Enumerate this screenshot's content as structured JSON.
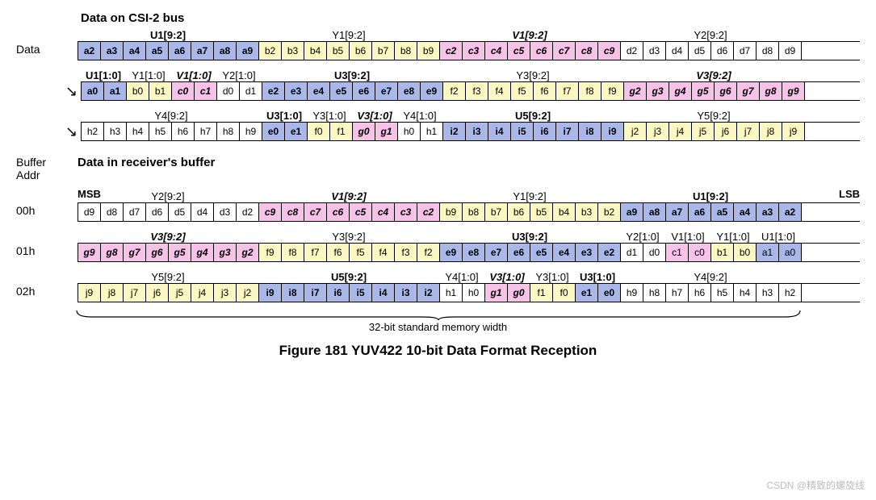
{
  "title": "Figure 181 YUV422 10-bit Data Format Reception",
  "memwidth": "32-bit standard memory width",
  "watermark": "CSDN @精致的螺旋线",
  "sections": {
    "bus": "Data on CSI-2 bus",
    "buf": "Data in receiver's buffer"
  },
  "labels": {
    "data": "Data",
    "bufaddr": "Buffer\nAddr",
    "msb": "MSB",
    "lsb": "LSB"
  },
  "bufaddrs": [
    "00h",
    "01h",
    "02h"
  ],
  "busHeaders": [
    [
      {
        "t": "U1[9:2]",
        "w": 8,
        "s": "bold"
      },
      {
        "t": "Y1[9:2]",
        "w": 8,
        "s": ""
      },
      {
        "t": "V1[9:2]",
        "w": 8,
        "s": "bold italic"
      },
      {
        "t": "Y2[9:2]",
        "w": 8,
        "s": ""
      }
    ],
    [
      {
        "t": "U1[1:0]",
        "w": 2,
        "s": "bold"
      },
      {
        "t": "Y1[1:0]",
        "w": 2,
        "s": ""
      },
      {
        "t": "V1[1:0]",
        "w": 2,
        "s": "bold italic"
      },
      {
        "t": "Y2[1:0]",
        "w": 2,
        "s": ""
      },
      {
        "t": "U3[9:2]",
        "w": 8,
        "s": "bold"
      },
      {
        "t": "Y3[9:2]",
        "w": 8,
        "s": ""
      },
      {
        "t": "V3[9:2]",
        "w": 8,
        "s": "bold italic"
      }
    ],
    [
      {
        "t": "Y4[9:2]",
        "w": 8,
        "s": ""
      },
      {
        "t": "U3[1:0]",
        "w": 2,
        "s": "bold"
      },
      {
        "t": "Y3[1:0]",
        "w": 2,
        "s": ""
      },
      {
        "t": "V3[1:0]",
        "w": 2,
        "s": "bold italic"
      },
      {
        "t": "Y4[1:0]",
        "w": 2,
        "s": ""
      },
      {
        "t": "U5[9:2]",
        "w": 8,
        "s": "bold"
      },
      {
        "t": "Y5[9:2]",
        "w": 8,
        "s": ""
      }
    ]
  ],
  "busRows": [
    [
      {
        "v": "a2",
        "c": "blue",
        "s": "bold"
      },
      {
        "v": "a3",
        "c": "blue",
        "s": "bold"
      },
      {
        "v": "a4",
        "c": "blue",
        "s": "bold"
      },
      {
        "v": "a5",
        "c": "blue",
        "s": "bold"
      },
      {
        "v": "a6",
        "c": "blue",
        "s": "bold"
      },
      {
        "v": "a7",
        "c": "blue",
        "s": "bold"
      },
      {
        "v": "a8",
        "c": "blue",
        "s": "bold"
      },
      {
        "v": "a9",
        "c": "blue",
        "s": "bold",
        "g": 1
      },
      {
        "v": "b2",
        "c": "yellow"
      },
      {
        "v": "b3",
        "c": "yellow"
      },
      {
        "v": "b4",
        "c": "yellow"
      },
      {
        "v": "b5",
        "c": "yellow"
      },
      {
        "v": "b6",
        "c": "yellow"
      },
      {
        "v": "b7",
        "c": "yellow"
      },
      {
        "v": "b8",
        "c": "yellow"
      },
      {
        "v": "b9",
        "c": "yellow",
        "g": 1
      },
      {
        "v": "c2",
        "c": "pink",
        "s": "bold italic"
      },
      {
        "v": "c3",
        "c": "pink",
        "s": "bold italic"
      },
      {
        "v": "c4",
        "c": "pink",
        "s": "bold italic"
      },
      {
        "v": "c5",
        "c": "pink",
        "s": "bold italic"
      },
      {
        "v": "c6",
        "c": "pink",
        "s": "bold italic"
      },
      {
        "v": "c7",
        "c": "pink",
        "s": "bold italic"
      },
      {
        "v": "c8",
        "c": "pink",
        "s": "bold italic"
      },
      {
        "v": "c9",
        "c": "pink",
        "s": "bold italic",
        "g": 1
      },
      {
        "v": "d2",
        "c": "white"
      },
      {
        "v": "d3",
        "c": "white"
      },
      {
        "v": "d4",
        "c": "white"
      },
      {
        "v": "d5",
        "c": "white"
      },
      {
        "v": "d6",
        "c": "white"
      },
      {
        "v": "d7",
        "c": "white"
      },
      {
        "v": "d8",
        "c": "white"
      },
      {
        "v": "d9",
        "c": "white"
      }
    ],
    [
      {
        "v": "a0",
        "c": "blue",
        "s": "bold"
      },
      {
        "v": "a1",
        "c": "blue",
        "s": "bold",
        "g": 1
      },
      {
        "v": "b0",
        "c": "yellow"
      },
      {
        "v": "b1",
        "c": "yellow",
        "g": 1
      },
      {
        "v": "c0",
        "c": "pink",
        "s": "bold italic"
      },
      {
        "v": "c1",
        "c": "pink",
        "s": "bold italic",
        "g": 1
      },
      {
        "v": "d0",
        "c": "white"
      },
      {
        "v": "d1",
        "c": "white",
        "g": 1
      },
      {
        "v": "e2",
        "c": "blue",
        "s": "bold"
      },
      {
        "v": "e3",
        "c": "blue",
        "s": "bold"
      },
      {
        "v": "e4",
        "c": "blue",
        "s": "bold"
      },
      {
        "v": "e5",
        "c": "blue",
        "s": "bold"
      },
      {
        "v": "e6",
        "c": "blue",
        "s": "bold"
      },
      {
        "v": "e7",
        "c": "blue",
        "s": "bold"
      },
      {
        "v": "e8",
        "c": "blue",
        "s": "bold"
      },
      {
        "v": "e9",
        "c": "blue",
        "s": "bold",
        "g": 1
      },
      {
        "v": "f2",
        "c": "yellow"
      },
      {
        "v": "f3",
        "c": "yellow"
      },
      {
        "v": "f4",
        "c": "yellow"
      },
      {
        "v": "f5",
        "c": "yellow"
      },
      {
        "v": "f6",
        "c": "yellow"
      },
      {
        "v": "f7",
        "c": "yellow"
      },
      {
        "v": "f8",
        "c": "yellow"
      },
      {
        "v": "f9",
        "c": "yellow",
        "g": 1
      },
      {
        "v": "g2",
        "c": "pink",
        "s": "bold italic"
      },
      {
        "v": "g3",
        "c": "pink",
        "s": "bold italic"
      },
      {
        "v": "g4",
        "c": "pink",
        "s": "bold italic"
      },
      {
        "v": "g5",
        "c": "pink",
        "s": "bold italic"
      },
      {
        "v": "g6",
        "c": "pink",
        "s": "bold italic"
      },
      {
        "v": "g7",
        "c": "pink",
        "s": "bold italic"
      },
      {
        "v": "g8",
        "c": "pink",
        "s": "bold italic"
      },
      {
        "v": "g9",
        "c": "pink",
        "s": "bold italic"
      }
    ],
    [
      {
        "v": "h2",
        "c": "white"
      },
      {
        "v": "h3",
        "c": "white"
      },
      {
        "v": "h4",
        "c": "white"
      },
      {
        "v": "h5",
        "c": "white"
      },
      {
        "v": "h6",
        "c": "white"
      },
      {
        "v": "h7",
        "c": "white"
      },
      {
        "v": "h8",
        "c": "white"
      },
      {
        "v": "h9",
        "c": "white",
        "g": 1
      },
      {
        "v": "e0",
        "c": "blue",
        "s": "bold"
      },
      {
        "v": "e1",
        "c": "blue",
        "s": "bold",
        "g": 1
      },
      {
        "v": "f0",
        "c": "yellow"
      },
      {
        "v": "f1",
        "c": "yellow",
        "g": 1
      },
      {
        "v": "g0",
        "c": "pink",
        "s": "bold italic"
      },
      {
        "v": "g1",
        "c": "pink",
        "s": "bold italic",
        "g": 1
      },
      {
        "v": "h0",
        "c": "white"
      },
      {
        "v": "h1",
        "c": "white",
        "g": 1
      },
      {
        "v": "i2",
        "c": "blue",
        "s": "bold"
      },
      {
        "v": "i3",
        "c": "blue",
        "s": "bold"
      },
      {
        "v": "i4",
        "c": "blue",
        "s": "bold"
      },
      {
        "v": "i5",
        "c": "blue",
        "s": "bold"
      },
      {
        "v": "i6",
        "c": "blue",
        "s": "bold"
      },
      {
        "v": "i7",
        "c": "blue",
        "s": "bold"
      },
      {
        "v": "i8",
        "c": "blue",
        "s": "bold"
      },
      {
        "v": "i9",
        "c": "blue",
        "s": "bold",
        "g": 1
      },
      {
        "v": "j2",
        "c": "yellow"
      },
      {
        "v": "j3",
        "c": "yellow"
      },
      {
        "v": "j4",
        "c": "yellow"
      },
      {
        "v": "j5",
        "c": "yellow"
      },
      {
        "v": "j6",
        "c": "yellow"
      },
      {
        "v": "j7",
        "c": "yellow"
      },
      {
        "v": "j8",
        "c": "yellow"
      },
      {
        "v": "j9",
        "c": "yellow"
      }
    ]
  ],
  "bufHeaders": [
    [
      {
        "t": "Y2[9:2]",
        "w": 8,
        "s": ""
      },
      {
        "t": "V1[9:2]",
        "w": 8,
        "s": "bold italic"
      },
      {
        "t": "Y1[9:2]",
        "w": 8,
        "s": ""
      },
      {
        "t": "U1[9:2]",
        "w": 8,
        "s": "bold"
      }
    ],
    [
      {
        "t": "V3[9:2]",
        "w": 8,
        "s": "bold italic"
      },
      {
        "t": "Y3[9:2]",
        "w": 8,
        "s": ""
      },
      {
        "t": "U3[9:2]",
        "w": 8,
        "s": "bold"
      },
      {
        "t": "Y2[1:0]",
        "w": 2,
        "s": ""
      },
      {
        "t": "V1[1:0]",
        "w": 2,
        "s": ""
      },
      {
        "t": "Y1[1:0]",
        "w": 2,
        "s": ""
      },
      {
        "t": "U1[1:0]",
        "w": 2,
        "s": ""
      }
    ],
    [
      {
        "t": "Y5[9:2]",
        "w": 8,
        "s": ""
      },
      {
        "t": "U5[9:2]",
        "w": 8,
        "s": "bold"
      },
      {
        "t": "Y4[1:0]",
        "w": 2,
        "s": ""
      },
      {
        "t": "V3[1:0]",
        "w": 2,
        "s": "bold italic"
      },
      {
        "t": "Y3[1:0]",
        "w": 2,
        "s": ""
      },
      {
        "t": "U3[1:0]",
        "w": 2,
        "s": "bold"
      },
      {
        "t": "Y4[9:2]",
        "w": 8,
        "s": ""
      }
    ]
  ],
  "bufRows": [
    [
      {
        "v": "d9",
        "c": "white"
      },
      {
        "v": "d8",
        "c": "white"
      },
      {
        "v": "d7",
        "c": "white"
      },
      {
        "v": "d6",
        "c": "white"
      },
      {
        "v": "d5",
        "c": "white"
      },
      {
        "v": "d4",
        "c": "white"
      },
      {
        "v": "d3",
        "c": "white"
      },
      {
        "v": "d2",
        "c": "white",
        "g": 1
      },
      {
        "v": "c9",
        "c": "pink",
        "s": "bold italic"
      },
      {
        "v": "c8",
        "c": "pink",
        "s": "bold italic"
      },
      {
        "v": "c7",
        "c": "pink",
        "s": "bold italic"
      },
      {
        "v": "c6",
        "c": "pink",
        "s": "bold italic"
      },
      {
        "v": "c5",
        "c": "pink",
        "s": "bold italic"
      },
      {
        "v": "c4",
        "c": "pink",
        "s": "bold italic"
      },
      {
        "v": "c3",
        "c": "pink",
        "s": "bold italic"
      },
      {
        "v": "c2",
        "c": "pink",
        "s": "bold italic",
        "g": 1
      },
      {
        "v": "b9",
        "c": "yellow"
      },
      {
        "v": "b8",
        "c": "yellow"
      },
      {
        "v": "b7",
        "c": "yellow"
      },
      {
        "v": "b6",
        "c": "yellow"
      },
      {
        "v": "b5",
        "c": "yellow"
      },
      {
        "v": "b4",
        "c": "yellow"
      },
      {
        "v": "b3",
        "c": "yellow"
      },
      {
        "v": "b2",
        "c": "yellow",
        "g": 1
      },
      {
        "v": "a9",
        "c": "blue",
        "s": "bold"
      },
      {
        "v": "a8",
        "c": "blue",
        "s": "bold"
      },
      {
        "v": "a7",
        "c": "blue",
        "s": "bold"
      },
      {
        "v": "a6",
        "c": "blue",
        "s": "bold"
      },
      {
        "v": "a5",
        "c": "blue",
        "s": "bold"
      },
      {
        "v": "a4",
        "c": "blue",
        "s": "bold"
      },
      {
        "v": "a3",
        "c": "blue",
        "s": "bold"
      },
      {
        "v": "a2",
        "c": "blue",
        "s": "bold"
      }
    ],
    [
      {
        "v": "g9",
        "c": "pink",
        "s": "bold italic"
      },
      {
        "v": "g8",
        "c": "pink",
        "s": "bold italic"
      },
      {
        "v": "g7",
        "c": "pink",
        "s": "bold italic"
      },
      {
        "v": "g6",
        "c": "pink",
        "s": "bold italic"
      },
      {
        "v": "g5",
        "c": "pink",
        "s": "bold italic"
      },
      {
        "v": "g4",
        "c": "pink",
        "s": "bold italic"
      },
      {
        "v": "g3",
        "c": "pink",
        "s": "bold italic"
      },
      {
        "v": "g2",
        "c": "pink",
        "s": "bold italic",
        "g": 1
      },
      {
        "v": "f9",
        "c": "yellow"
      },
      {
        "v": "f8",
        "c": "yellow"
      },
      {
        "v": "f7",
        "c": "yellow"
      },
      {
        "v": "f6",
        "c": "yellow"
      },
      {
        "v": "f5",
        "c": "yellow"
      },
      {
        "v": "f4",
        "c": "yellow"
      },
      {
        "v": "f3",
        "c": "yellow"
      },
      {
        "v": "f2",
        "c": "yellow",
        "g": 1
      },
      {
        "v": "e9",
        "c": "blue",
        "s": "bold"
      },
      {
        "v": "e8",
        "c": "blue",
        "s": "bold"
      },
      {
        "v": "e7",
        "c": "blue",
        "s": "bold"
      },
      {
        "v": "e6",
        "c": "blue",
        "s": "bold"
      },
      {
        "v": "e5",
        "c": "blue",
        "s": "bold"
      },
      {
        "v": "e4",
        "c": "blue",
        "s": "bold"
      },
      {
        "v": "e3",
        "c": "blue",
        "s": "bold"
      },
      {
        "v": "e2",
        "c": "blue",
        "s": "bold",
        "g": 1
      },
      {
        "v": "d1",
        "c": "white"
      },
      {
        "v": "d0",
        "c": "white",
        "g": 1
      },
      {
        "v": "c1",
        "c": "pink"
      },
      {
        "v": "c0",
        "c": "pink",
        "g": 1
      },
      {
        "v": "b1",
        "c": "yellow"
      },
      {
        "v": "b0",
        "c": "yellow",
        "g": 1
      },
      {
        "v": "a1",
        "c": "blue"
      },
      {
        "v": "a0",
        "c": "blue"
      }
    ],
    [
      {
        "v": "j9",
        "c": "yellow"
      },
      {
        "v": "j8",
        "c": "yellow"
      },
      {
        "v": "j7",
        "c": "yellow"
      },
      {
        "v": "j6",
        "c": "yellow"
      },
      {
        "v": "j5",
        "c": "yellow"
      },
      {
        "v": "j4",
        "c": "yellow"
      },
      {
        "v": "j3",
        "c": "yellow"
      },
      {
        "v": "j2",
        "c": "yellow",
        "g": 1
      },
      {
        "v": "i9",
        "c": "blue",
        "s": "bold"
      },
      {
        "v": "i8",
        "c": "blue",
        "s": "bold"
      },
      {
        "v": "i7",
        "c": "blue",
        "s": "bold"
      },
      {
        "v": "i6",
        "c": "blue",
        "s": "bold"
      },
      {
        "v": "i5",
        "c": "blue",
        "s": "bold"
      },
      {
        "v": "i4",
        "c": "blue",
        "s": "bold"
      },
      {
        "v": "i3",
        "c": "blue",
        "s": "bold"
      },
      {
        "v": "i2",
        "c": "blue",
        "s": "bold",
        "g": 1
      },
      {
        "v": "h1",
        "c": "white"
      },
      {
        "v": "h0",
        "c": "white",
        "g": 1
      },
      {
        "v": "g1",
        "c": "pink",
        "s": "bold italic"
      },
      {
        "v": "g0",
        "c": "pink",
        "s": "bold italic",
        "g": 1
      },
      {
        "v": "f1",
        "c": "yellow"
      },
      {
        "v": "f0",
        "c": "yellow",
        "g": 1
      },
      {
        "v": "e1",
        "c": "blue",
        "s": "bold"
      },
      {
        "v": "e0",
        "c": "blue",
        "s": "bold",
        "g": 1
      },
      {
        "v": "h9",
        "c": "white"
      },
      {
        "v": "h8",
        "c": "white"
      },
      {
        "v": "h7",
        "c": "white"
      },
      {
        "v": "h6",
        "c": "white"
      },
      {
        "v": "h5",
        "c": "white"
      },
      {
        "v": "h4",
        "c": "white"
      },
      {
        "v": "h3",
        "c": "white"
      },
      {
        "v": "h2",
        "c": "white"
      }
    ]
  ]
}
